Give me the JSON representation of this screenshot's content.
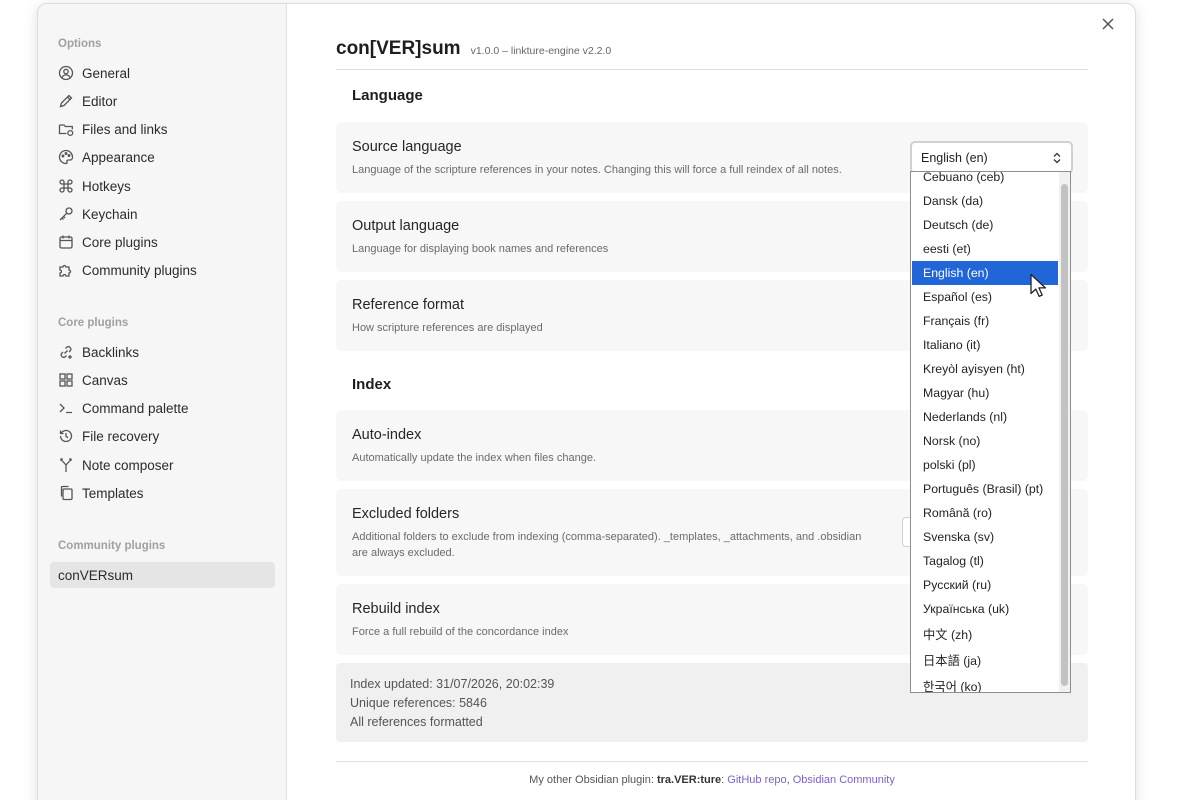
{
  "sidebar": {
    "options_heading": "Options",
    "options": [
      {
        "label": "General",
        "icon": "user-circle-icon"
      },
      {
        "label": "Editor",
        "icon": "pencil-icon"
      },
      {
        "label": "Files and links",
        "icon": "folder-link-icon"
      },
      {
        "label": "Appearance",
        "icon": "palette-icon"
      },
      {
        "label": "Hotkeys",
        "icon": "command-icon"
      },
      {
        "label": "Keychain",
        "icon": "key-icon"
      },
      {
        "label": "Core plugins",
        "icon": "calendar-box-icon"
      },
      {
        "label": "Community plugins",
        "icon": "puzzle-icon"
      }
    ],
    "core_heading": "Core plugins",
    "core": [
      {
        "label": "Backlinks",
        "icon": "backlink-icon"
      },
      {
        "label": "Canvas",
        "icon": "grid-icon"
      },
      {
        "label": "Command palette",
        "icon": "terminal-icon"
      },
      {
        "label": "File recovery",
        "icon": "history-icon"
      },
      {
        "label": "Note composer",
        "icon": "merge-icon"
      },
      {
        "label": "Templates",
        "icon": "files-icon"
      }
    ],
    "community_heading": "Community plugins",
    "community": [
      {
        "label": "conVERsum",
        "active": true
      }
    ]
  },
  "header": {
    "title": "con[VER]sum",
    "version": "v1.0.0 – linkture-engine v2.2.0"
  },
  "sections": {
    "language": "Language",
    "index": "Index"
  },
  "settings": {
    "source_language": {
      "name": "Source language",
      "desc": "Language of the scripture references in your notes. Changing this will force a full reindex of all notes.",
      "value": "English (en)"
    },
    "output_language": {
      "name": "Output language",
      "desc": "Language for displaying book names and references"
    },
    "reference_format": {
      "name": "Reference format",
      "desc": "How scripture references are displayed"
    },
    "auto_index": {
      "name": "Auto-index",
      "desc": "Automatically update the index when files change."
    },
    "excluded_folders": {
      "name": "Excluded folders",
      "desc": "Additional folders to exclude from indexing (comma-separated). _templates, _attachments, and .obsidian are always excluded."
    },
    "rebuild_index": {
      "name": "Rebuild index",
      "desc": "Force a full rebuild of the concordance index"
    }
  },
  "stats": {
    "updated": "Index updated: 31/07/2026, 20:02:39",
    "unique": "Unique references: 5846",
    "formatted": "All references formatted"
  },
  "footer": {
    "prefix": "My other Obsidian plugin: ",
    "plugin": "tra.VER:ture",
    "colon": ": ",
    "github": "GitHub repo",
    "comma": ", ",
    "community": "Obsidian Community"
  },
  "dropdown": {
    "selected": "English (en)",
    "options": [
      "Cebuano (ceb)",
      "Dansk (da)",
      "Deutsch (de)",
      "eesti (et)",
      "English (en)",
      "Español (es)",
      "Français (fr)",
      "Italiano (it)",
      "Kreyòl ayisyen (ht)",
      "Magyar (hu)",
      "Nederlands (nl)",
      "Norsk (no)",
      "polski (pl)",
      "Português (Brasil) (pt)",
      "Română (ro)",
      "Svenska (sv)",
      "Tagalog (tl)",
      "Русский (ru)",
      "Українська (uk)",
      "中文 (zh)",
      "日本語 (ja)",
      "한국어 (ko)"
    ]
  },
  "colors": {
    "selection": "#2166d9",
    "link": "#7b63c8"
  }
}
